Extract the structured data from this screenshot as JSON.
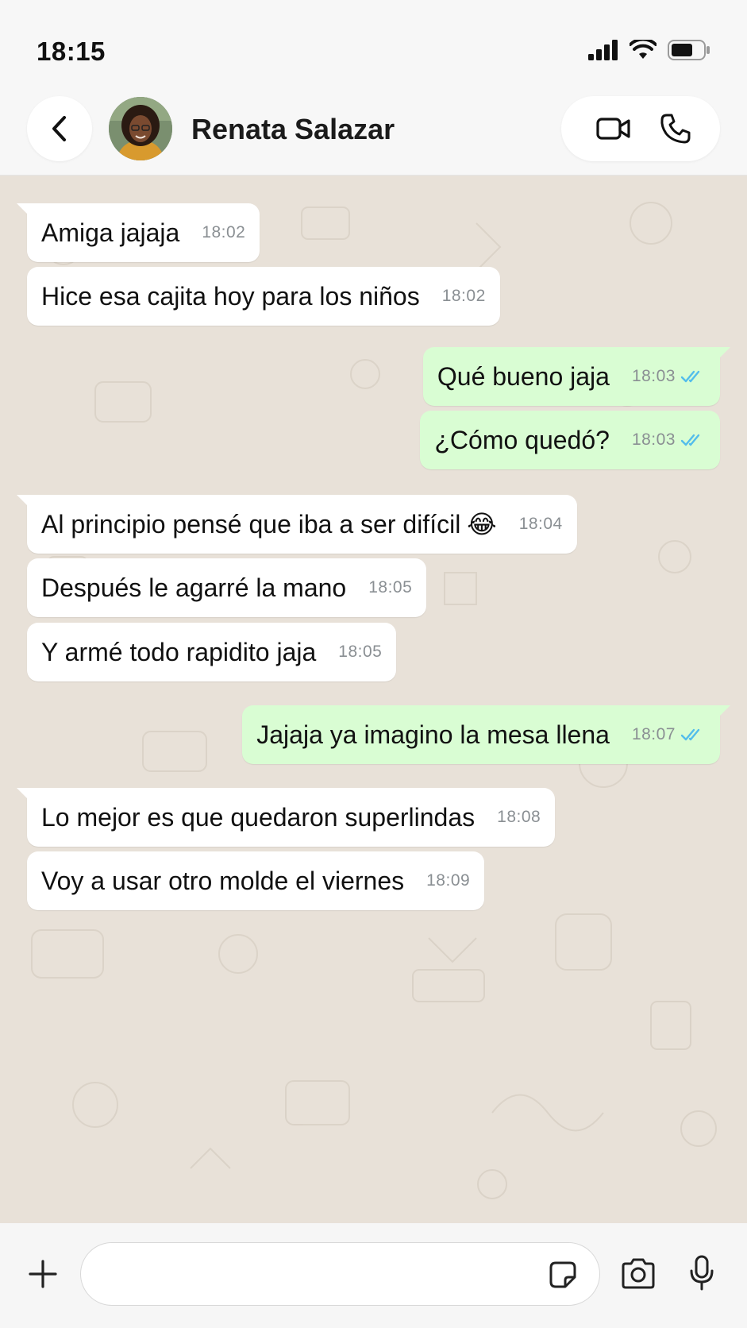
{
  "status_bar": {
    "time": "18:15"
  },
  "header": {
    "contact_name": "Renata Salazar",
    "icons": [
      "back-chevron-icon",
      "avatar",
      "video-call-icon",
      "phone-call-icon"
    ]
  },
  "messages": [
    {
      "dir": "in",
      "text": "Amiga jajaja",
      "time": "18:02"
    },
    {
      "dir": "in",
      "text": "Hice esa cajita hoy para los niños",
      "time": "18:02"
    },
    {
      "dir": "out",
      "text": "Qué bueno jaja",
      "time": "18:03",
      "status": "read"
    },
    {
      "dir": "out",
      "text": "¿Cómo quedó?",
      "time": "18:03",
      "status": "read"
    },
    {
      "dir": "in",
      "text": "Al principio pensé que iba a ser difícil",
      "emoji": "😂",
      "time": "18:04"
    },
    {
      "dir": "in",
      "text": "Después le agarré la mano",
      "time": "18:05"
    },
    {
      "dir": "in",
      "text": "Y armé todo rapidito jaja",
      "time": "18:05"
    },
    {
      "dir": "out",
      "text": "Jajaja ya imagino la mesa llena",
      "time": "18:07",
      "status": "read"
    },
    {
      "dir": "in",
      "text": "Lo mejor es que quedaron superlindas",
      "time": "18:08"
    },
    {
      "dir": "in",
      "text": "Voy a usar otro molde el viernes",
      "time": "18:09"
    }
  ],
  "input_bar": {
    "placeholder": "",
    "icons": [
      "plus-icon",
      "sticker-icon",
      "camera-icon",
      "microphone-icon"
    ]
  },
  "colors": {
    "incoming_bubble": "#ffffff",
    "outgoing_bubble": "#d9fdd3",
    "chat_background": "#e8e1d8",
    "read_ticks": "#53bdeb"
  }
}
